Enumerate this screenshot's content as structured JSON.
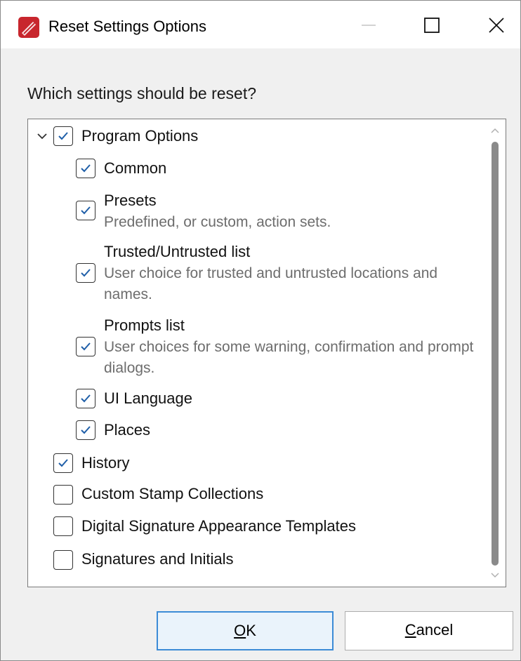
{
  "window": {
    "title": "Reset Settings Options",
    "icon": "pdf-app-icon",
    "controls": [
      "minimize-icon",
      "maximize-icon",
      "close-icon"
    ]
  },
  "prompt": "Which settings should be reset?",
  "tree": {
    "items": [
      {
        "label": "Program Options",
        "checked": true,
        "expanded": true,
        "level": 0
      },
      {
        "label": "Common",
        "checked": true,
        "level": 1
      },
      {
        "label": "Presets",
        "description": "Predefined, or custom, action sets.",
        "checked": true,
        "level": 1
      },
      {
        "label": "Trusted/Untrusted list",
        "description": "User choice for trusted and untrusted locations and names.",
        "checked": true,
        "level": 1
      },
      {
        "label": "Prompts list",
        "description": "User choices for some warning, confirmation and prompt dialogs.",
        "checked": true,
        "level": 1
      },
      {
        "label": "UI Language",
        "checked": true,
        "level": 1
      },
      {
        "label": "Places",
        "checked": true,
        "level": 1
      },
      {
        "label": "History",
        "checked": true,
        "level": 0
      },
      {
        "label": "Custom Stamp Collections",
        "checked": false,
        "level": 0
      },
      {
        "label": "Digital Signature Appearance Templates",
        "checked": false,
        "level": 0
      },
      {
        "label": "Signatures and Initials",
        "checked": false,
        "level": 0
      }
    ]
  },
  "buttons": {
    "ok": {
      "mnemonic": "O",
      "rest": "K"
    },
    "cancel": {
      "mnemonic": "C",
      "rest": "ancel"
    }
  },
  "colors": {
    "check": "#1f5fa8",
    "focus_border": "#3c8bd6",
    "icon_red": "#c8262d"
  }
}
